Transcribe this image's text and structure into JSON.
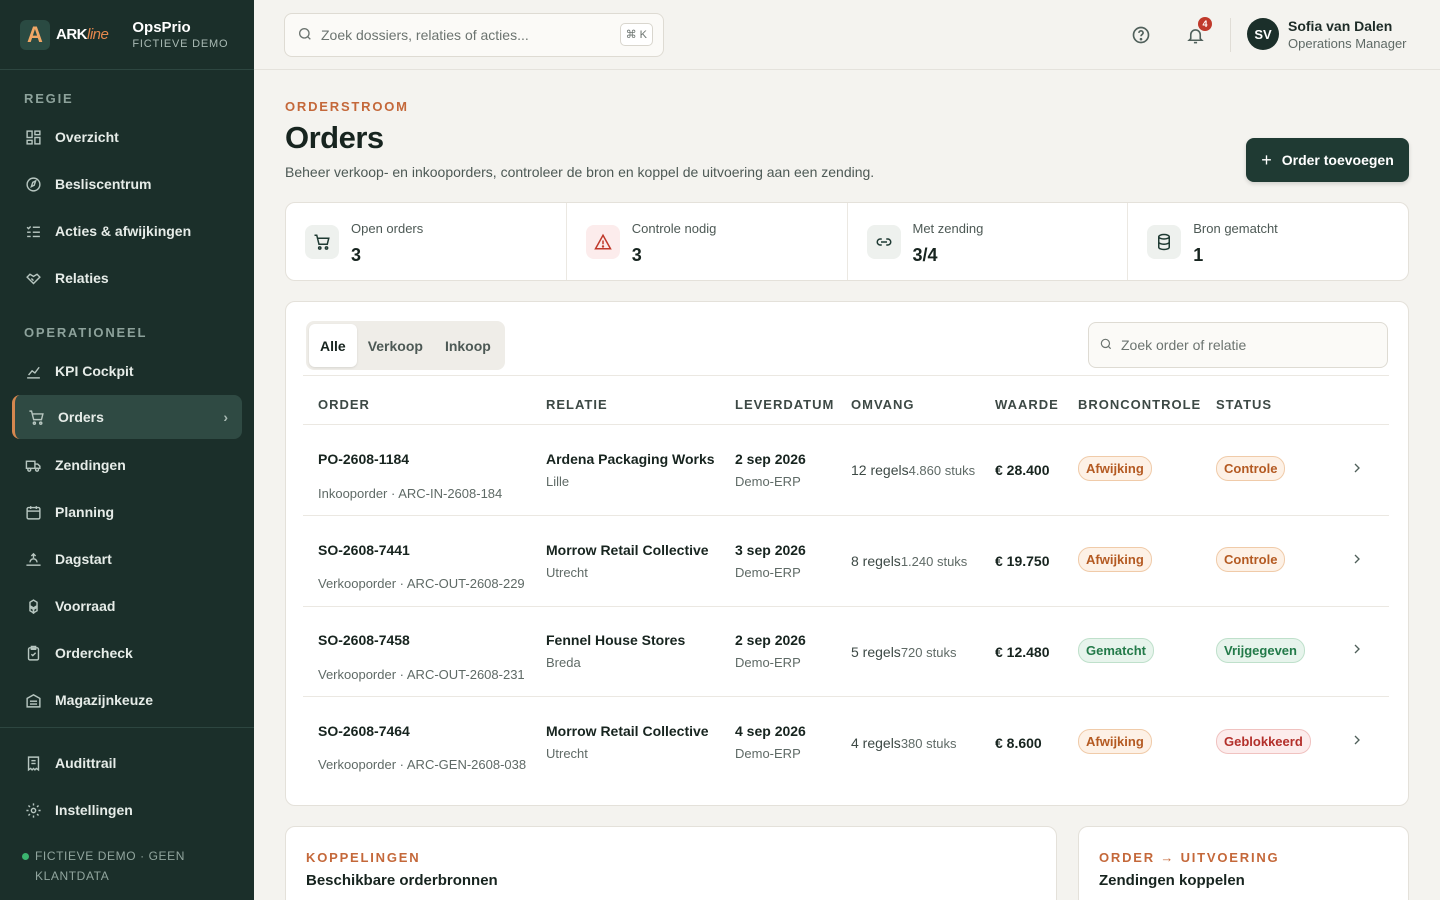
{
  "brand": {
    "logo_letter": "A",
    "logo_text_a": "ARK",
    "logo_text_b": "line",
    "app_name": "OpsPrio",
    "app_sub": "FICTIEVE DEMO"
  },
  "sidebar": {
    "section_regie": "REGIE",
    "section_operationeel": "OPERATIONEEL",
    "items": [
      {
        "label": "Overzicht",
        "icon": "grid-icon"
      },
      {
        "label": "Besliscentrum",
        "icon": "compass-icon"
      },
      {
        "label": "Acties & afwijkingen",
        "icon": "list-check-icon"
      },
      {
        "label": "Relaties",
        "icon": "handshake-icon"
      },
      {
        "label": "KPI Cockpit",
        "icon": "chart-icon"
      },
      {
        "label": "Orders",
        "icon": "cart-icon",
        "active": true
      },
      {
        "label": "Zendingen",
        "icon": "truck-icon"
      },
      {
        "label": "Planning",
        "icon": "calendar-icon"
      },
      {
        "label": "Dagstart",
        "icon": "sunrise-icon"
      },
      {
        "label": "Voorraad",
        "icon": "boxes-icon"
      },
      {
        "label": "Ordercheck",
        "icon": "clipboard-check-icon"
      },
      {
        "label": "Magazijnkeuze",
        "icon": "warehouse-icon"
      },
      {
        "label": "Audittrail",
        "icon": "receipt-icon"
      },
      {
        "label": "Instellingen",
        "icon": "gear-icon"
      }
    ],
    "demo_note": "FICTIEVE DEMO · GEEN KLANTDATA"
  },
  "topbar": {
    "search_placeholder": "Zoek dossiers, relaties of acties...",
    "search_shortcut": "⌘ K",
    "notification_count": "4",
    "user_initials": "SV",
    "user_name": "Sofia van Dalen",
    "user_role": "Operations Manager"
  },
  "header": {
    "eyebrow": "ORDERSTROOM",
    "title": "Orders",
    "description": "Beheer verkoop- en inkooporders, controleer de bron en koppel de uitvoering aan een zending.",
    "add_button": "Order toevoegen"
  },
  "stats": [
    {
      "label": "Open orders",
      "value": "3",
      "icon": "cart-icon"
    },
    {
      "label": "Controle nodig",
      "value": "3",
      "icon": "warning-icon"
    },
    {
      "label": "Met zending",
      "value": "3/4",
      "icon": "link-icon"
    },
    {
      "label": "Bron gematcht",
      "value": "1",
      "icon": "database-icon"
    }
  ],
  "orders": {
    "tabs": [
      "Alle",
      "Verkoop",
      "Inkoop"
    ],
    "active_tab": "Alle",
    "filter_placeholder": "Zoek order of relatie",
    "columns": [
      "ORDER",
      "RELATIE",
      "LEVERDATUM",
      "OMVANG",
      "WAARDE",
      "BRONCONTROLE",
      "STATUS"
    ],
    "rows": [
      {
        "id": "PO-2608-1184",
        "type": "Inkooporder · ARC-IN-2608-184",
        "relation": "Ardena Packaging Works",
        "city": "Lille",
        "date": "2 sep 2026",
        "source": "Demo-ERP",
        "lines": "12 regels",
        "pieces": "4.860 stuks",
        "value": "€ 28.400",
        "check": "Afwijking",
        "check_kind": "warn",
        "status": "Controle",
        "status_kind": "warn"
      },
      {
        "id": "SO-2608-7441",
        "type": "Verkooporder · ARC-OUT-2608-229",
        "relation": "Morrow Retail Collective",
        "city": "Utrecht",
        "date": "3 sep 2026",
        "source": "Demo-ERP",
        "lines": "8 regels",
        "pieces": "1.240 stuks",
        "value": "€ 19.750",
        "check": "Afwijking",
        "check_kind": "warn",
        "status": "Controle",
        "status_kind": "warn"
      },
      {
        "id": "SO-2608-7458",
        "type": "Verkooporder · ARC-OUT-2608-231",
        "relation": "Fennel House Stores",
        "city": "Breda",
        "date": "2 sep 2026",
        "source": "Demo-ERP",
        "lines": "5 regels",
        "pieces": "720 stuks",
        "value": "€ 12.480",
        "check": "Gematcht",
        "check_kind": "ok",
        "status": "Vrijgegeven",
        "status_kind": "ok"
      },
      {
        "id": "SO-2608-7464",
        "type": "Verkooporder · ARC-GEN-2608-038",
        "relation": "Morrow Retail Collective",
        "city": "Utrecht",
        "date": "4 sep 2026",
        "source": "Demo-ERP",
        "lines": "4 regels",
        "pieces": "380 stuks",
        "value": "€ 8.600",
        "check": "Afwijking",
        "check_kind": "warn",
        "status": "Geblokkeerd",
        "status_kind": "bad"
      }
    ]
  },
  "bottom": {
    "left_eyebrow": "KOPPELINGEN",
    "left_title": "Beschikbare orderbronnen",
    "right_eyebrow": "ORDER → UITVOERING",
    "right_title": "Zendingen koppelen"
  }
}
